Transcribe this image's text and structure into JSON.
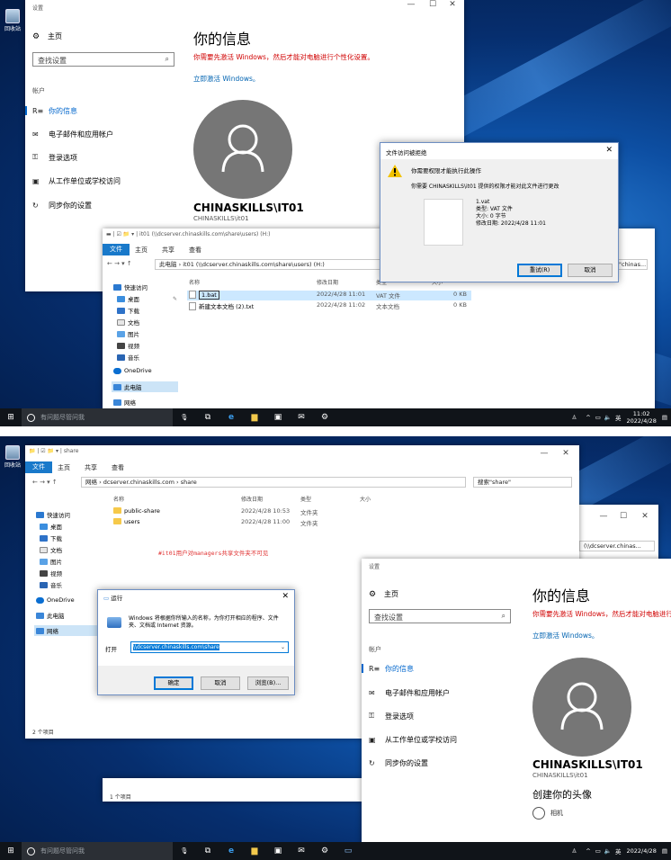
{
  "desktop": {
    "recycle_bin_label": "回收站"
  },
  "top": {
    "settings": {
      "window_title": "设置",
      "home": "主页",
      "search_placeholder": "查找设置",
      "section_label": "帐户",
      "nav": [
        {
          "label": "你的信息",
          "icon": "person-card-icon",
          "active": true
        },
        {
          "label": "电子邮件和应用帐户",
          "icon": "mail-icon",
          "active": false
        },
        {
          "label": "登录选项",
          "icon": "key-icon",
          "active": false
        },
        {
          "label": "从工作单位或学校访问",
          "icon": "briefcase-icon",
          "active": false
        },
        {
          "label": "同步你的设置",
          "icon": "sync-icon",
          "active": false
        }
      ],
      "heading": "你的信息",
      "activation_warning": "你需要先激活 Windows，然后才能对电脑进行个性化设置。",
      "activate_link": "立即激活 Windows。",
      "user_name": "CHINASKILLS\\IT01",
      "user_sub": "CHINASKILLS\\it01"
    },
    "explorer": {
      "title": "it01 (\\\\dcserver.chinaskills.com\\share\\users) (H:)",
      "ribbon_tabs": [
        "文件",
        "主页",
        "共享",
        "查看"
      ],
      "address": "此电脑  ›  it01 (\\\\dcserver.chinaskills.com\\share\\users) (H:)",
      "search_placeholder": "搜索\"chinas...",
      "nav_items": [
        "快速访问",
        "桌面",
        "下载",
        "文档",
        "图片",
        "视频",
        "音乐",
        "OneDrive",
        "此电脑",
        "网络"
      ],
      "columns": [
        "名称",
        "修改日期",
        "类型",
        "大小"
      ],
      "files": [
        {
          "name": "1.bat",
          "date": "2022/4/28 11:01",
          "type": "VAT 文件",
          "size": "0 KB"
        },
        {
          "name": "新建文本文档 (2).txt",
          "date": "2022/4/28 11:02",
          "type": "文本文档",
          "size": "0 KB"
        }
      ]
    },
    "access_dialog": {
      "title": "文件访问被拒绝",
      "line1": "你需要权限才能执行此操作",
      "line2": "你需要 CHINASKILLS\\it01 提供的权限才能对此文件进行更改",
      "file_name": "1.vat",
      "file_type": "类型: VAT 文件",
      "file_size": "大小: 0 字节",
      "file_date": "修改日期: 2022/4/28 11:01",
      "retry": "重试(R)",
      "cancel": "取消"
    },
    "taskbar": {
      "search_text": "有问题尽管问我",
      "time": "11:02",
      "date": "2022/4/28",
      "ime": "英"
    }
  },
  "bottom": {
    "explorer": {
      "title": "share",
      "ribbon_tabs": [
        "文件",
        "主页",
        "共享",
        "查看"
      ],
      "address": "网络  ›  dcserver.chinaskills.com  ›  share",
      "search_placeholder": "搜索\"share\"",
      "nav_items": [
        "快速访问",
        "桌面",
        "下载",
        "文档",
        "图片",
        "视频",
        "音乐",
        "OneDrive",
        "此电脑",
        "网络"
      ],
      "columns": [
        "名称",
        "修改日期",
        "类型",
        "大小"
      ],
      "folders": [
        {
          "name": "public-share",
          "date": "2022/4/28 10:53",
          "type": "文件夹"
        },
        {
          "name": "users",
          "date": "2022/4/28 11:00",
          "type": "文件夹"
        }
      ],
      "status": "2 个项目",
      "status2": "1 个项目",
      "back_search": "(\\\\dcserver.chinas..."
    },
    "annotation": "#it01用户对managers共享文件夹不可见",
    "run_dialog": {
      "title": "运行",
      "desc": "Windows 将根据你所输入的名称，为你打开相应的程序、文件夹、文档或 Internet 资源。",
      "open_label": "打开",
      "value": "\\\\dcserver.chinaskills.com\\share",
      "ok": "确定",
      "cancel": "取消",
      "browse": "浏览(B)..."
    },
    "settings": {
      "window_title": "设置",
      "home": "主页",
      "search_placeholder": "查找设置",
      "section_label": "帐户",
      "nav": [
        {
          "label": "你的信息",
          "icon": "person-card-icon",
          "active": true
        },
        {
          "label": "电子邮件和应用帐户",
          "icon": "mail-icon",
          "active": false
        },
        {
          "label": "登录选项",
          "icon": "key-icon",
          "active": false
        },
        {
          "label": "从工作单位或学校访问",
          "icon": "briefcase-icon",
          "active": false
        },
        {
          "label": "同步你的设置",
          "icon": "sync-icon",
          "active": false
        }
      ],
      "heading": "你的信息",
      "activation_warning": "你需要先激活 Windows，然后才能对电脑进行个性化设置。",
      "activate_link": "立即激活 Windows。",
      "user_name": "CHINASKILLS\\IT01",
      "user_sub": "CHINASKILLS\\it01",
      "create_avatar": "创建你的头像",
      "camera": "相机"
    },
    "taskbar": {
      "search_text": "有问题尽管问我",
      "date": "2022/4/28",
      "ime": "英"
    }
  }
}
